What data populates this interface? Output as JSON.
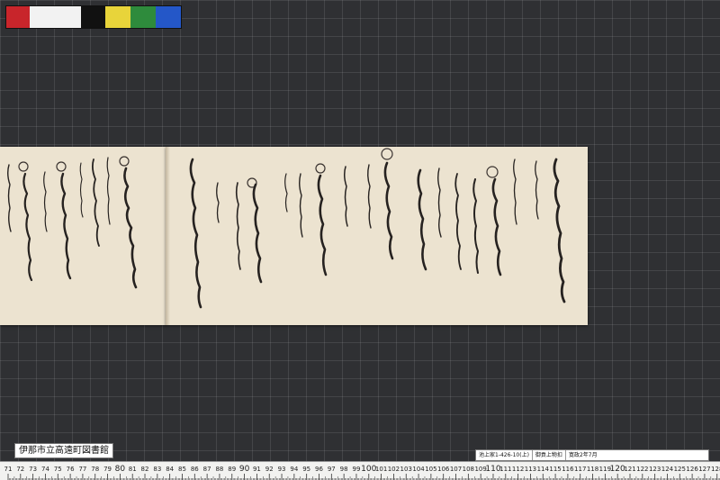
{
  "color_chart": {
    "swatches": [
      "#c8252b",
      "#f2f2f2",
      "#111111",
      "#e8d43a",
      "#2e8b3c",
      "#2457c8"
    ]
  },
  "library_label": "伊那市立高遠町図書館",
  "catalog": {
    "call_number": "池上家1-426-10(上)",
    "title": "御貢上物扣",
    "date": "寛政2年7月"
  },
  "ruler": {
    "start": 71,
    "end": 128
  },
  "colors": {
    "paper": "#ece3d0",
    "ink": "#262220",
    "board": "#2f3033"
  }
}
